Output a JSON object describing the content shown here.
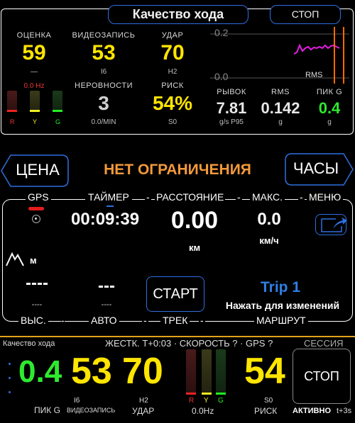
{
  "header": {
    "title": "Качество хода",
    "stop_label": "СТОП"
  },
  "stats": {
    "score": {
      "label": "ОЦЕНКА",
      "value": "59",
      "sub": "—"
    },
    "video": {
      "label": "ВИДЕОЗАПИСЬ",
      "value": "53",
      "sub": "I6"
    },
    "impact": {
      "label": "УДАР",
      "value": "70",
      "sub": "H2"
    },
    "hz": "0.0 Hz",
    "irregularity": {
      "label": "НЕРОВНОСТИ",
      "value": "3",
      "sub": "0.0/MIN"
    },
    "risk": {
      "label": "РИСК",
      "value": "54%",
      "sub": "S0"
    },
    "led_labels": [
      "R",
      "Y",
      "G"
    ]
  },
  "graph": {
    "y_top": "0.2",
    "y_bottom": "0.0",
    "series_label": "RMS",
    "line_color": "#e21ee2",
    "marker_color": "#ff6a00"
  },
  "metrics": [
    {
      "label": "РЫВОК",
      "value": "7.81",
      "unit": "g/s P95",
      "color": "#e8e8e8"
    },
    {
      "label": "RMS",
      "value": "0.142",
      "unit": "g",
      "color": "#e8e8e8"
    },
    {
      "label": "ПИК G",
      "value": "0.4",
      "unit": "g",
      "color": "#2eea2e"
    }
  ],
  "nav": {
    "price": "ЦЕНА",
    "status": "НЕТ ОГРАНИЧЕНИЯ",
    "clock": "ЧАСЫ"
  },
  "tabs": {
    "gps": "GPS",
    "timer": "ТАЙМЕР",
    "distance": "РАССТОЯНИЕ",
    "max": "МАКС.",
    "menu": "МЕНЮ"
  },
  "trip": {
    "timer": "00:09:39",
    "distance": "0.00",
    "distance_unit": "км",
    "max_speed": "0.0",
    "speed_unit": "км/ч",
    "altitude_unit": "м",
    "alt_value": "----",
    "alt_sub": "----",
    "auto_value": "---",
    "auto_sub": "----",
    "start": "СТАРТ",
    "trip_name": "Trip 1",
    "trip_hint": "Нажать для изменений"
  },
  "bottom_tabs": {
    "alt": "ВЫС.",
    "auto": "АВТО",
    "track": "ТРЕК",
    "route": "МАРШРУТ"
  },
  "footer": {
    "title": "Качество хода",
    "status": "ЖЕСТК. T+0:03 · СКОРОСТЬ ? · GPS ?",
    "session": "СЕССИЯ",
    "peak_g": "0.4",
    "peak_label": "ПИК G",
    "video": "53",
    "video_sub": "I6",
    "video_label": "ВИДЕОЗАПИСЬ",
    "impact": "70",
    "impact_sub": "H2",
    "impact_label": "УДАР",
    "hz": "0.0Hz",
    "risk": "54",
    "risk_sub": "S0",
    "risk_label": "РИСК",
    "stop": "СТОП",
    "active": "АКТИВНО",
    "t_offset": "t+3s",
    "led_labels": [
      "R",
      "Y",
      "G"
    ]
  }
}
